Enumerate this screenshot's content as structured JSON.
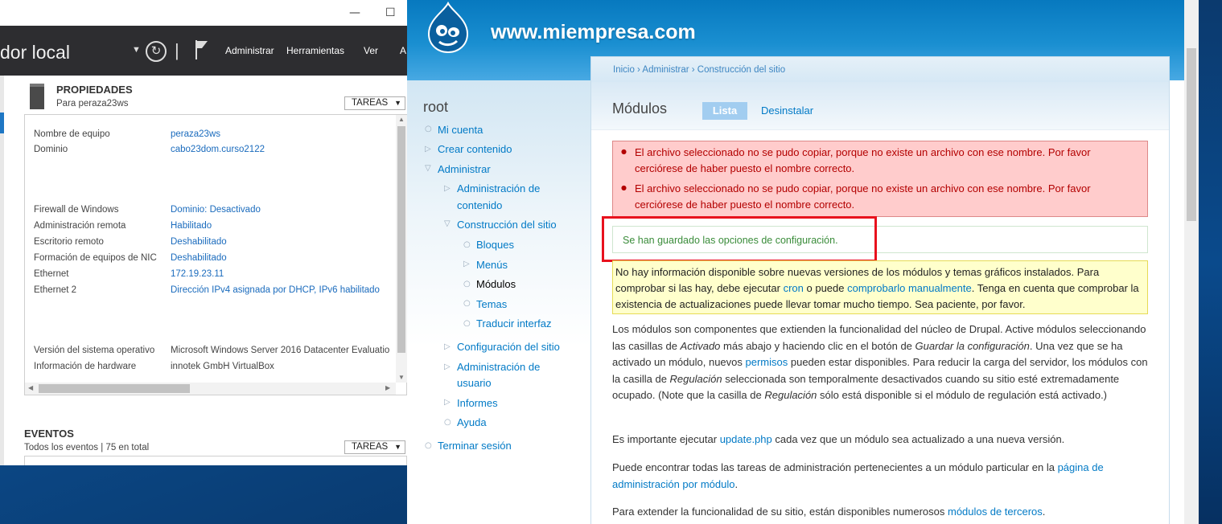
{
  "server_manager": {
    "window_buttons": {
      "minimize": "—",
      "maximize": "☐"
    },
    "title": "dor local",
    "menu": [
      "Administrar",
      "Herramientas",
      "Ver",
      "A"
    ],
    "properties": {
      "title": "PROPIEDADES",
      "subtitle": "Para peraza23ws",
      "tasks_label": "TAREAS",
      "rows": [
        {
          "label": "Nombre de equipo",
          "value": "peraza23ws"
        },
        {
          "label": "Dominio",
          "value": "cabo23dom.curso2122"
        },
        {
          "label": "Firewall de Windows",
          "value": "Dominio: Desactivado"
        },
        {
          "label": "Administración remota",
          "value": "Habilitado"
        },
        {
          "label": "Escritorio remoto",
          "value": "Deshabilitado"
        },
        {
          "label": "Formación de equipos de NIC",
          "value": "Deshabilitado"
        },
        {
          "label": "Ethernet",
          "value": "172.19.23.11"
        },
        {
          "label": "Ethernet 2",
          "value": "Dirección IPv4 asignada por DHCP, IPv6 habilitado"
        },
        {
          "label": "Versión del sistema operativo",
          "value": "Microsoft Windows Server 2016 Datacenter Evaluatio"
        },
        {
          "label": "Información de hardware",
          "value": "innotek GmbH VirtualBox"
        }
      ]
    },
    "events": {
      "title": "EVENTOS",
      "subtitle": "Todos los eventos | 75 en total",
      "tasks_label": "TAREAS"
    }
  },
  "drupal": {
    "site_name": "www.miempresa.com",
    "user": "root",
    "nav": {
      "my_account": "Mi cuenta",
      "create_content": "Crear contenido",
      "administer": "Administrar",
      "content_admin_1": "Administración de",
      "content_admin_2": "contenido",
      "site_building": "Construcción del sitio",
      "blocks": "Bloques",
      "menus": "Menús",
      "modules": "Módulos",
      "themes": "Temas",
      "translate": "Traducir interfaz",
      "site_config": "Configuración del sitio",
      "user_admin_1": "Administración de",
      "user_admin_2": "usuario",
      "reports": "Informes",
      "help": "Ayuda",
      "logout": "Terminar sesión"
    },
    "breadcrumb": "Inicio › Administrar › Construcción del sitio",
    "page_title": "Módulos",
    "tabs": {
      "list": "Lista",
      "uninstall": "Desinstalar"
    },
    "errors": [
      "El archivo seleccionado no se pudo copiar, porque no existe un archivo con ese nombre. Por favor cerciórese de haber puesto el nombre correcto.",
      "El archivo seleccionado no se pudo copiar, porque no existe un archivo con ese nombre. Por favor cerciórese de haber puesto el nombre correcto."
    ],
    "status": "Se han guardado las opciones de configuración.",
    "warning": {
      "t1": "No hay información disponible sobre nuevas versiones de los módulos y temas gráficos instalados. Para comprobar si las hay, debe ejecutar ",
      "l1": "cron",
      "t2": " o puede ",
      "l2": "comprobarlo manualmente",
      "t3": ". Tenga en cuenta que comprobar la existencia de actualizaciones puede llevar tomar mucho tiempo. Sea paciente, por favor."
    },
    "p1": {
      "t1": "Los módulos son componentes que extienden la funcionalidad del núcleo de Drupal. Active módulos seleccionando las casillas de ",
      "e1": "Activado",
      "t2": " más abajo y haciendo clic en el botón de ",
      "e2": "Guardar la configuración",
      "t3": ". Una vez que se ha activado un módulo, nuevos ",
      "l1": "permisos",
      "t4": " pueden estar disponibles. Para reducir la carga del servidor, los módulos con la casilla de ",
      "e3": "Regulación",
      "t5": " seleccionada son temporalmente desactivados cuando su sitio esté extremadamente ocupado. (Note que la casilla de ",
      "e4": "Regulación",
      "t6": " sólo está disponible si el módulo de regulación está activado.)"
    },
    "p2": {
      "t1": "Es importante ejecutar ",
      "l1": "update.php",
      "t2": " cada vez que un módulo sea actualizado a una nueva versión."
    },
    "p3": {
      "t1": "Puede encontrar todas las tareas de administración pertenecientes a un módulo particular en la ",
      "l1": "página de administración por módulo",
      "t2": "."
    },
    "p4": {
      "t1": "Para extender la funcionalidad de su sitio, están disponibles numerosos ",
      "l1": "módulos de terceros",
      "t2": "."
    }
  },
  "colors": {
    "drupal_blue": "#027ac6",
    "error_bg": "#ffcccc",
    "highlight": "#e8111d",
    "warning_bg": "#ffffcc"
  },
  "icons": [
    "refresh-icon",
    "flag-icon",
    "server-icon",
    "drupal-logo",
    "bullet-icon"
  ]
}
